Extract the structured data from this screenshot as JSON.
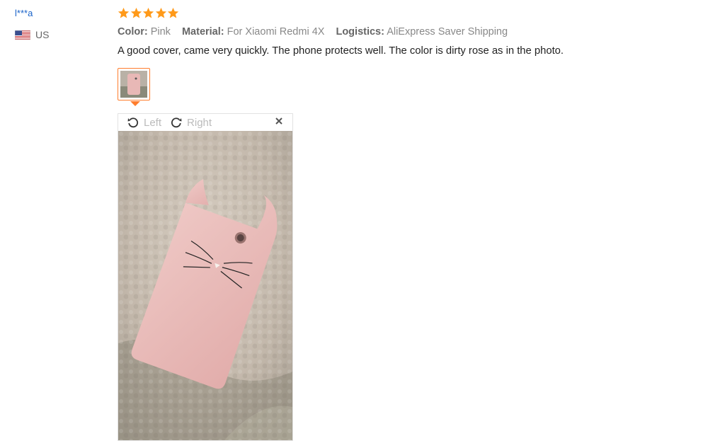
{
  "review": {
    "user_name": "l***a",
    "country": "US",
    "rating": 5,
    "attributes": [
      {
        "key": "Color:",
        "value": "Pink"
      },
      {
        "key": "Material:",
        "value": "For Xiaomi Redmi 4X"
      },
      {
        "key": "Logistics:",
        "value": "AliExpress Saver Shipping"
      }
    ],
    "text": "A good cover, came very quickly. The phone protects well. The color is dirty rose as in the photo."
  },
  "viewer": {
    "rotate_left_label": "Left",
    "rotate_right_label": "Right"
  },
  "colors": {
    "accent": "#ff7d2d",
    "star": "#ff9a1a",
    "username": "#1a63c9"
  },
  "icons": {
    "rotate_left": "rotate-left-icon",
    "rotate_right": "rotate-right-icon",
    "close": "close-icon",
    "flag": "us-flag-icon"
  }
}
